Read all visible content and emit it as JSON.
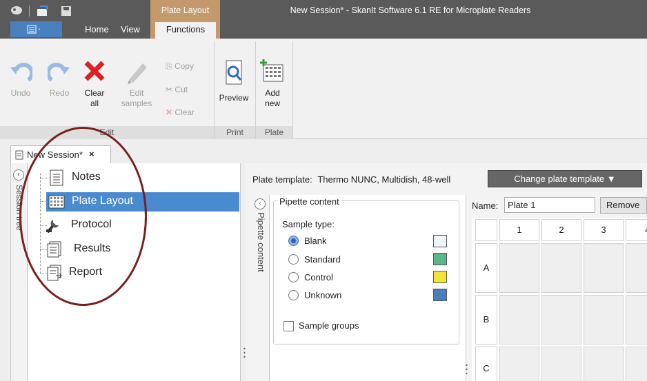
{
  "window": {
    "title": "New Session* - SkanIt Software 6.1 RE for Microplate Readers",
    "context_tab": "Plate Layout"
  },
  "menu": {
    "file_tab": "·",
    "tabs": [
      "Home",
      "View",
      "Functions"
    ]
  },
  "ribbon": {
    "edit": {
      "undo": "Undo",
      "redo": "Redo",
      "clear_all": [
        "Clear",
        "all"
      ],
      "edit_samples": [
        "Edit",
        "samples"
      ],
      "copy": "Copy",
      "cut": "Cut",
      "clear": "Clear",
      "group_label": "Edit"
    },
    "print": {
      "preview": "Preview",
      "group_label": "Print"
    },
    "plate": {
      "add_new": [
        "Add",
        "new"
      ],
      "group_label": "Plate"
    }
  },
  "document_tab": {
    "title": "New Session*",
    "close": "×"
  },
  "session_tree": {
    "panel_label": "Session tree",
    "items": [
      {
        "label": "Notes",
        "icon": "notes-icon",
        "selected": false
      },
      {
        "label": "Plate Layout",
        "icon": "plate-layout-icon",
        "selected": true
      },
      {
        "label": "Protocol",
        "icon": "protocol-icon",
        "selected": false
      },
      {
        "label": "Results",
        "icon": "results-icon",
        "selected": false
      },
      {
        "label": "Report",
        "icon": "report-icon",
        "selected": false
      }
    ]
  },
  "plate": {
    "template_label": "Plate template:",
    "template_value": "Thermo NUNC, Multidish, 48-well",
    "change_button": "Change plate template ▼",
    "name_label": "Name:",
    "name_value": "Plate 1",
    "remove_button": "Remove",
    "columns": [
      "1",
      "2",
      "3",
      "4"
    ],
    "rows": [
      "A",
      "B",
      "C"
    ]
  },
  "pipette": {
    "panel_label": "Pipette content",
    "legend": "Pipette content",
    "sample_type_label": "Sample type:",
    "sample_types": [
      {
        "label": "Blank",
        "selected": true,
        "color": "#eef4f8"
      },
      {
        "label": "Standard",
        "selected": false,
        "color": "#5db58a"
      },
      {
        "label": "Control",
        "selected": false,
        "color": "#f0e33a"
      },
      {
        "label": "Unknown",
        "selected": false,
        "color": "#4a7ebd"
      }
    ],
    "sample_groups": "Sample groups"
  },
  "colors": {
    "title_bar": "#5a5a5a",
    "context_tab": "#c49a6c",
    "selection": "#4a8bd0",
    "annotation_circle": "#7a1f1f"
  }
}
